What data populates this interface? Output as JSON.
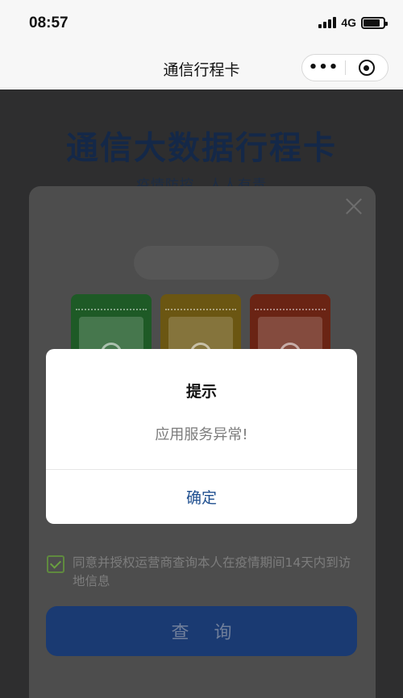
{
  "status_bar": {
    "time": "08:57",
    "network": "4G",
    "battery_level": 0.85,
    "icons": [
      "signal-icon",
      "battery-icon"
    ]
  },
  "nav_bar": {
    "title": "通信行程卡",
    "more_label": "•••",
    "icons": [
      "more-icon",
      "mini-program-close-icon"
    ]
  },
  "page": {
    "title": "通信大数据行程卡",
    "subtitle": "疫情防控，人人有责"
  },
  "query_card": {
    "icons": [
      "close-icon",
      "green-card-icon",
      "yellow-card-icon",
      "red-card-icon",
      "checkbox-checked-icon"
    ],
    "agreement_checked": true,
    "agreement_text": "同意并授权运营商查询本人在疫情期间14天内到访地信息",
    "query_button_label": "查 询",
    "colors": {
      "green": "#1e5a26",
      "yellow": "#6b5612",
      "red": "#6a2414",
      "button": "#1a3a72"
    }
  },
  "alert": {
    "title": "提示",
    "message": "应用服务异常!",
    "confirm_label": "确定"
  }
}
